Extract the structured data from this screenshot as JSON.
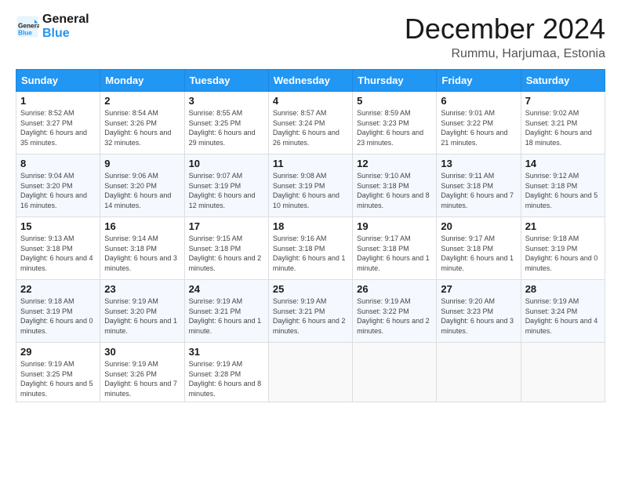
{
  "logo": {
    "line1": "General",
    "line2": "Blue"
  },
  "title": "December 2024",
  "location": "Rummu, Harjumaa, Estonia",
  "days_of_week": [
    "Sunday",
    "Monday",
    "Tuesday",
    "Wednesday",
    "Thursday",
    "Friday",
    "Saturday"
  ],
  "weeks": [
    [
      {
        "num": "1",
        "rise": "8:52 AM",
        "set": "3:27 PM",
        "daylight": "6 hours and 35 minutes."
      },
      {
        "num": "2",
        "rise": "8:54 AM",
        "set": "3:26 PM",
        "daylight": "6 hours and 32 minutes."
      },
      {
        "num": "3",
        "rise": "8:55 AM",
        "set": "3:25 PM",
        "daylight": "6 hours and 29 minutes."
      },
      {
        "num": "4",
        "rise": "8:57 AM",
        "set": "3:24 PM",
        "daylight": "6 hours and 26 minutes."
      },
      {
        "num": "5",
        "rise": "8:59 AM",
        "set": "3:23 PM",
        "daylight": "6 hours and 23 minutes."
      },
      {
        "num": "6",
        "rise": "9:01 AM",
        "set": "3:22 PM",
        "daylight": "6 hours and 21 minutes."
      },
      {
        "num": "7",
        "rise": "9:02 AM",
        "set": "3:21 PM",
        "daylight": "6 hours and 18 minutes."
      }
    ],
    [
      {
        "num": "8",
        "rise": "9:04 AM",
        "set": "3:20 PM",
        "daylight": "6 hours and 16 minutes."
      },
      {
        "num": "9",
        "rise": "9:06 AM",
        "set": "3:20 PM",
        "daylight": "6 hours and 14 minutes."
      },
      {
        "num": "10",
        "rise": "9:07 AM",
        "set": "3:19 PM",
        "daylight": "6 hours and 12 minutes."
      },
      {
        "num": "11",
        "rise": "9:08 AM",
        "set": "3:19 PM",
        "daylight": "6 hours and 10 minutes."
      },
      {
        "num": "12",
        "rise": "9:10 AM",
        "set": "3:18 PM",
        "daylight": "6 hours and 8 minutes."
      },
      {
        "num": "13",
        "rise": "9:11 AM",
        "set": "3:18 PM",
        "daylight": "6 hours and 7 minutes."
      },
      {
        "num": "14",
        "rise": "9:12 AM",
        "set": "3:18 PM",
        "daylight": "6 hours and 5 minutes."
      }
    ],
    [
      {
        "num": "15",
        "rise": "9:13 AM",
        "set": "3:18 PM",
        "daylight": "6 hours and 4 minutes."
      },
      {
        "num": "16",
        "rise": "9:14 AM",
        "set": "3:18 PM",
        "daylight": "6 hours and 3 minutes."
      },
      {
        "num": "17",
        "rise": "9:15 AM",
        "set": "3:18 PM",
        "daylight": "6 hours and 2 minutes."
      },
      {
        "num": "18",
        "rise": "9:16 AM",
        "set": "3:18 PM",
        "daylight": "6 hours and 1 minute."
      },
      {
        "num": "19",
        "rise": "9:17 AM",
        "set": "3:18 PM",
        "daylight": "6 hours and 1 minute."
      },
      {
        "num": "20",
        "rise": "9:17 AM",
        "set": "3:18 PM",
        "daylight": "6 hours and 1 minute."
      },
      {
        "num": "21",
        "rise": "9:18 AM",
        "set": "3:19 PM",
        "daylight": "6 hours and 0 minutes."
      }
    ],
    [
      {
        "num": "22",
        "rise": "9:18 AM",
        "set": "3:19 PM",
        "daylight": "6 hours and 0 minutes."
      },
      {
        "num": "23",
        "rise": "9:19 AM",
        "set": "3:20 PM",
        "daylight": "6 hours and 1 minute."
      },
      {
        "num": "24",
        "rise": "9:19 AM",
        "set": "3:21 PM",
        "daylight": "6 hours and 1 minute."
      },
      {
        "num": "25",
        "rise": "9:19 AM",
        "set": "3:21 PM",
        "daylight": "6 hours and 2 minutes."
      },
      {
        "num": "26",
        "rise": "9:19 AM",
        "set": "3:22 PM",
        "daylight": "6 hours and 2 minutes."
      },
      {
        "num": "27",
        "rise": "9:20 AM",
        "set": "3:23 PM",
        "daylight": "6 hours and 3 minutes."
      },
      {
        "num": "28",
        "rise": "9:19 AM",
        "set": "3:24 PM",
        "daylight": "6 hours and 4 minutes."
      }
    ],
    [
      {
        "num": "29",
        "rise": "9:19 AM",
        "set": "3:25 PM",
        "daylight": "6 hours and 5 minutes."
      },
      {
        "num": "30",
        "rise": "9:19 AM",
        "set": "3:26 PM",
        "daylight": "6 hours and 7 minutes."
      },
      {
        "num": "31",
        "rise": "9:19 AM",
        "set": "3:28 PM",
        "daylight": "6 hours and 8 minutes."
      },
      null,
      null,
      null,
      null
    ]
  ]
}
